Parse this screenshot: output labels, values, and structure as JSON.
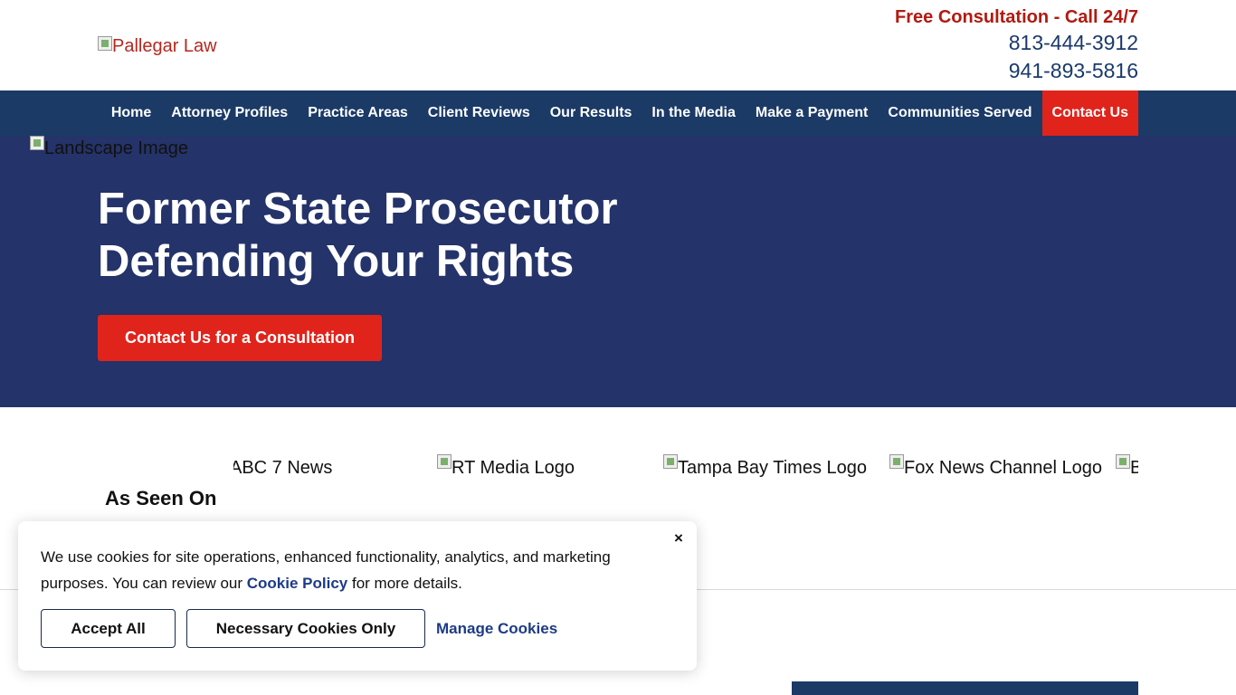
{
  "header": {
    "logo_alt": "Pallegar Law",
    "free_consultation": "Free Consultation - Call 24/7",
    "phones": [
      "813-444-3912",
      "941-893-5816"
    ]
  },
  "nav": {
    "items": [
      "Home",
      "Attorney Profiles",
      "Practice Areas",
      "Client Reviews",
      "Our Results",
      "In the Media",
      "Make a Payment",
      "Communities Served",
      "Contact Us"
    ],
    "active": "Contact Us"
  },
  "hero": {
    "image_alt": "Landscape Image",
    "title_line1": "Former State Prosecutor",
    "title_line2": "Defending Your Rights",
    "cta_label": "Contact Us for a Consultation"
  },
  "media": {
    "heading": "As Seen On",
    "items": [
      "ABC 7 News",
      "RT Media Logo",
      "Tampa Bay Times Logo",
      "Fox News Channel Logo",
      "B"
    ]
  },
  "cookie": {
    "text_before_link": "We use cookies for site operations, enhanced functionality, analytics, and marketing purposes. You can review our ",
    "link_label": "Cookie Policy",
    "text_after_link": " for more details.",
    "accept_label": "Accept All",
    "necessary_label": "Necessary Cookies Only",
    "manage_label": "Manage Cookies",
    "close_label": "×"
  },
  "colors": {
    "nav_bg": "#1b3a66",
    "hero_bg": "#243369",
    "accent_red": "#e0241b",
    "phone_blue": "#1a3a6b",
    "consult_red": "#b11a10",
    "link_blue": "#1d3b85"
  }
}
